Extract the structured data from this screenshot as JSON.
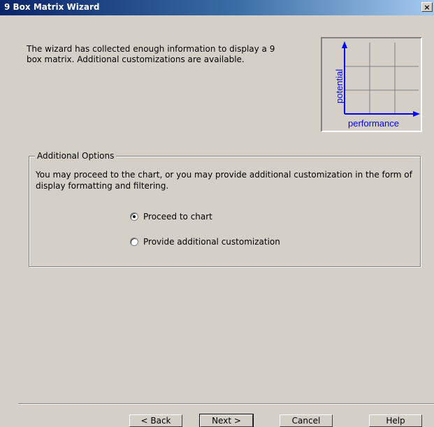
{
  "window": {
    "title": "9 Box Matrix Wizard",
    "close_glyph": "×"
  },
  "intro_text": "The wizard has collected enough information to display a 9 box matrix. Additional customizations are available.",
  "thumbnail": {
    "y_label": "potential",
    "x_label": "performance",
    "axis_color": "#0000ff"
  },
  "options": {
    "legend": "Additional Options",
    "description": "You may proceed to the chart, or you may provide additional customization in the form of display formatting and filtering.",
    "choices": [
      {
        "label": "Proceed to chart",
        "selected": true
      },
      {
        "label": "Provide additional customization",
        "selected": false
      }
    ]
  },
  "buttons": {
    "back": "< Back",
    "next": "Next >",
    "cancel": "Cancel",
    "help": "Help"
  }
}
